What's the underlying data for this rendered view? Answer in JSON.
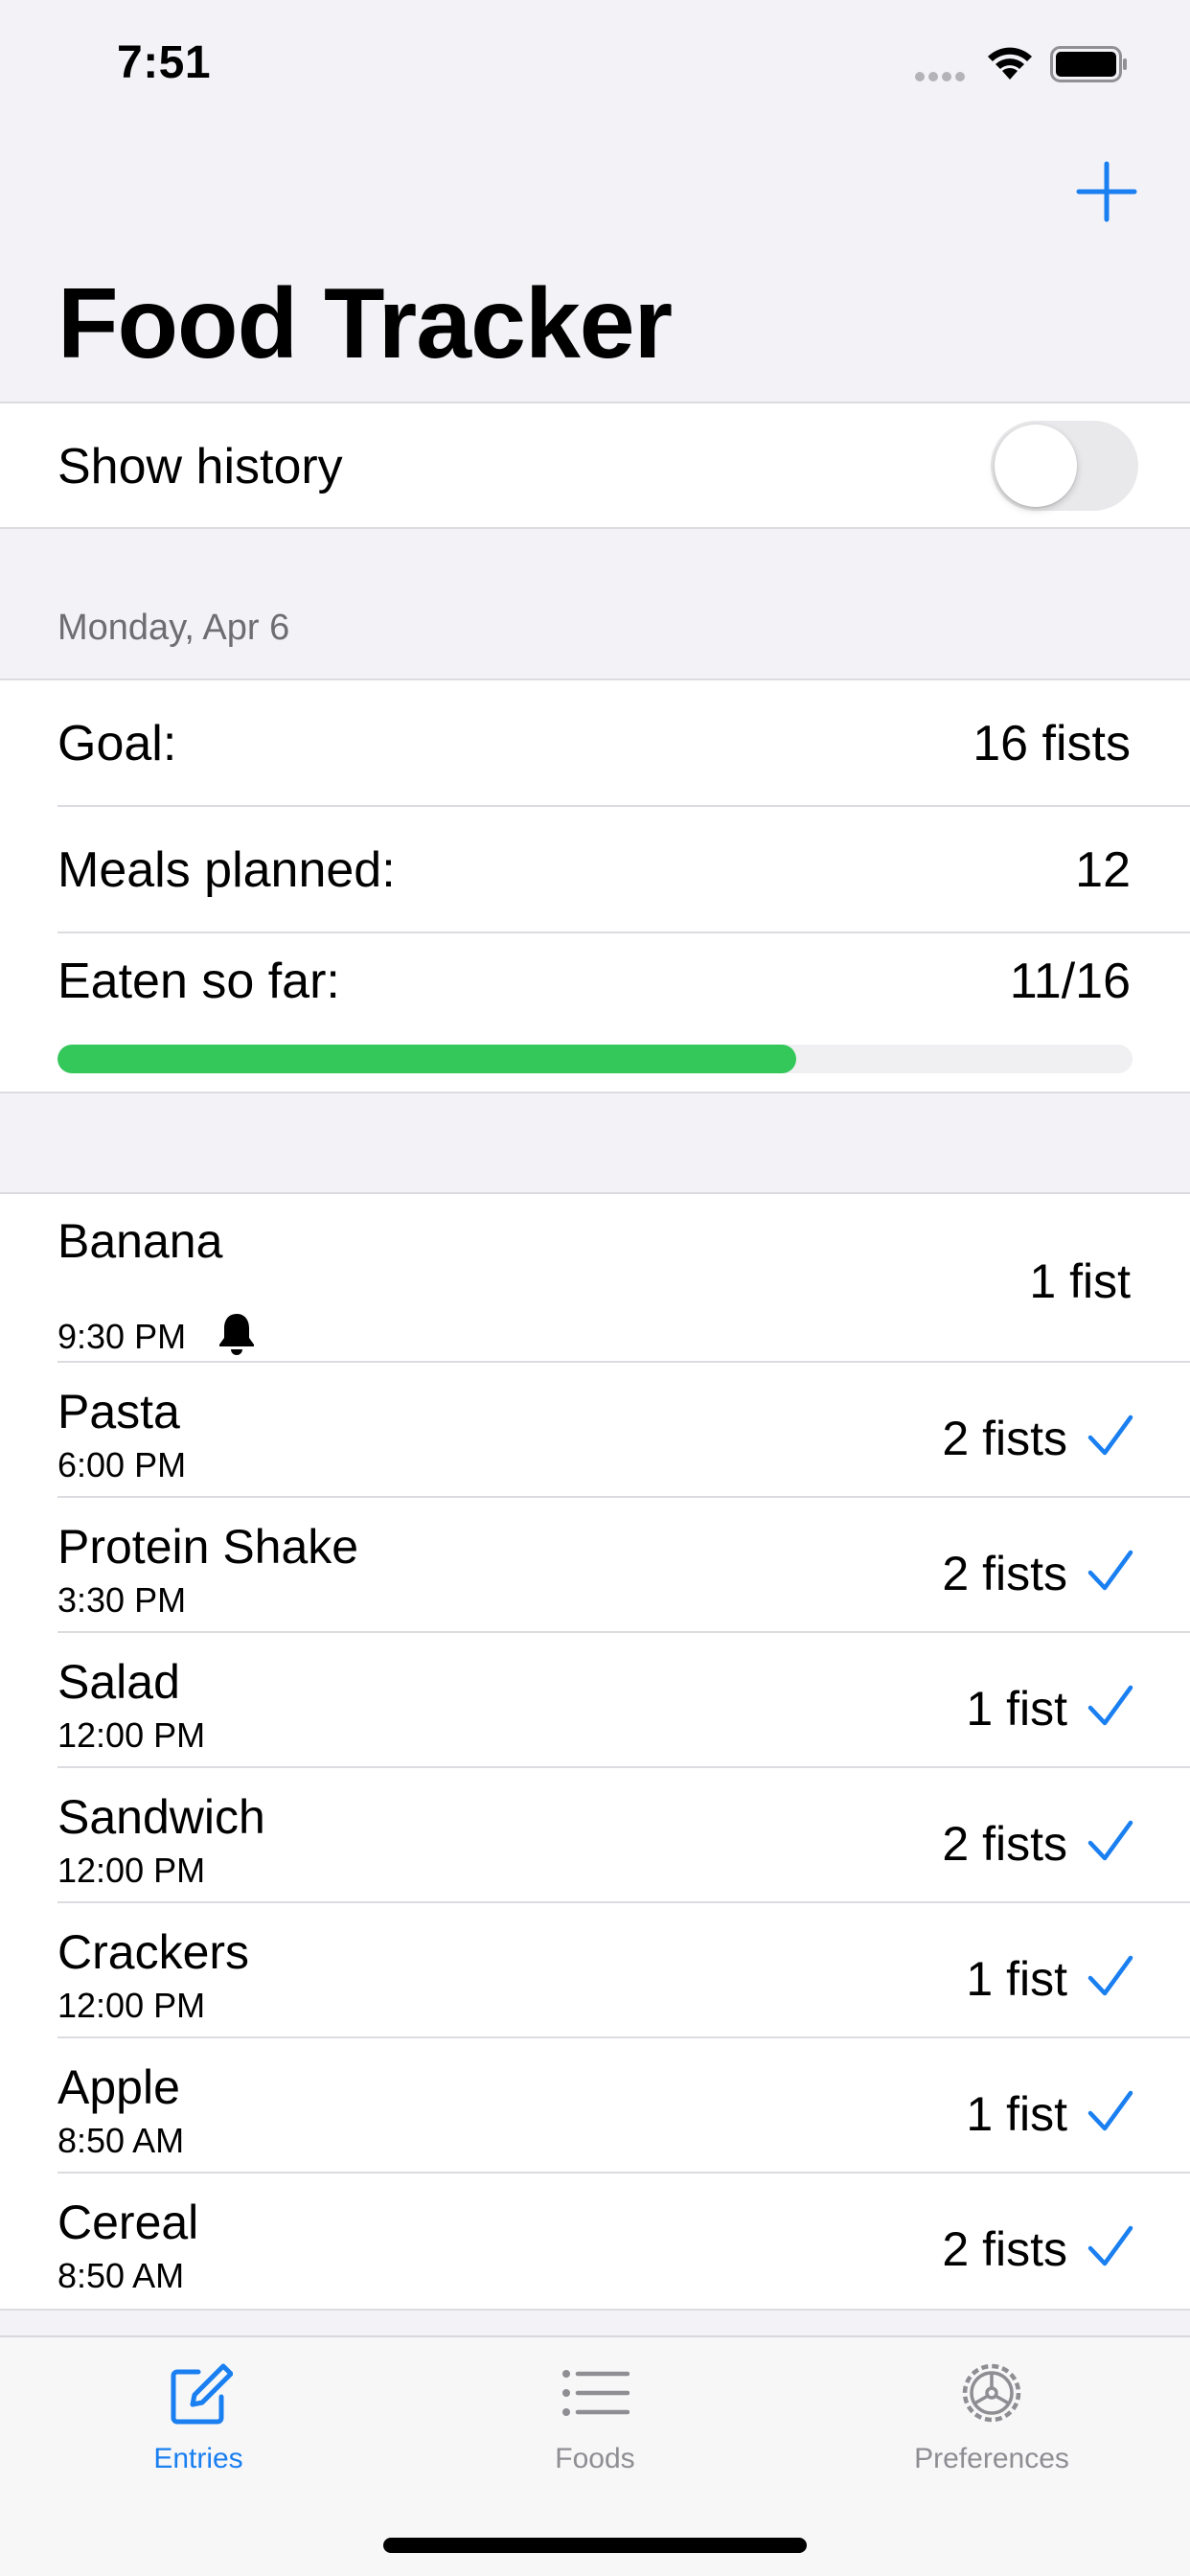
{
  "status_bar": {
    "time": "7:51"
  },
  "nav": {
    "title": "Food Tracker",
    "add_icon": "plus-icon"
  },
  "settings": {
    "show_history_label": "Show history",
    "show_history_on": false
  },
  "day": {
    "header": "Monday, Apr 6",
    "goal_label": "Goal:",
    "goal_value": "16 fists",
    "planned_label": "Meals planned:",
    "planned_value": "12",
    "eaten_label": "Eaten so far:",
    "eaten_value": "11/16",
    "progress": 0.6875
  },
  "meals": [
    {
      "name": "Banana",
      "time": "9:30 PM",
      "qty": "1 fist",
      "reminder": true,
      "done": false
    },
    {
      "name": "Pasta",
      "time": "6:00 PM",
      "qty": "2 fists",
      "done": true
    },
    {
      "name": "Protein Shake",
      "time": "3:30 PM",
      "qty": "2 fists",
      "done": true
    },
    {
      "name": "Salad",
      "time": "12:00 PM",
      "qty": "1 fist",
      "done": true
    },
    {
      "name": "Sandwich",
      "time": "12:00 PM",
      "qty": "2 fists",
      "done": true
    },
    {
      "name": "Crackers",
      "time": "12:00 PM",
      "qty": "1 fist",
      "done": true
    },
    {
      "name": "Apple",
      "time": "8:50 AM",
      "qty": "1 fist",
      "done": true
    },
    {
      "name": "Cereal",
      "time": "8:50 AM",
      "qty": "2 fists",
      "done": true
    }
  ],
  "tabs": [
    {
      "label": "Entries",
      "icon": "compose-icon",
      "active": true
    },
    {
      "label": "Foods",
      "icon": "list-icon",
      "active": false
    },
    {
      "label": "Preferences",
      "icon": "gear-icon",
      "active": false
    }
  ],
  "colors": {
    "accent": "#1a7ff0",
    "progress": "#34c759",
    "inactive_tab": "#8e8e93",
    "background": "#f2f2f7"
  }
}
